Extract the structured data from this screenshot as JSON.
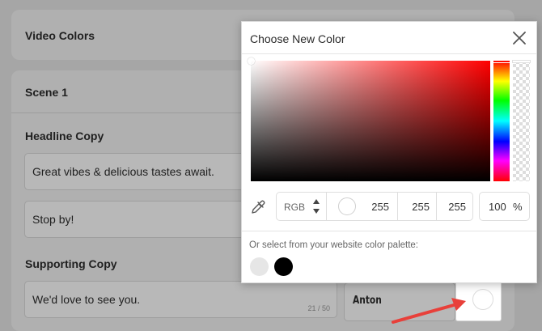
{
  "background": {
    "video_colors_title": "Video Colors",
    "scene_title": "Scene 1",
    "headline_label": "Headline Copy",
    "headline_value": "Great vibes & delicious tastes await.",
    "subheadline_value": "Stop by!",
    "supporting_label": "Supporting Copy",
    "supporting_value": "We'd love to see you.",
    "supporting_counter": "21 / 50",
    "font_name": "Anton"
  },
  "picker": {
    "title": "Choose New Color",
    "mode": "RGB",
    "r": "255",
    "g": "255",
    "b": "255",
    "alpha": "100",
    "alpha_unit": "%",
    "palette_label": "Or select from your website color palette:",
    "selected_color": "#ffffff",
    "palette": [
      {
        "color": "#e6e6e6",
        "icon": "light-gray-swatch"
      },
      {
        "color": "#000000",
        "icon": "black-swatch"
      }
    ]
  },
  "colors": {
    "overlay": "#a6a6a6",
    "arrow": "#e8403a"
  }
}
